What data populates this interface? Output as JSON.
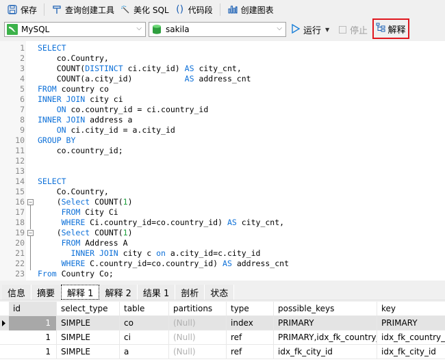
{
  "toolbar": {
    "save": "保存",
    "query_builder": "查询创建工具",
    "beautify": "美化 SQL",
    "snippet": "代码段",
    "create_chart": "创建图表"
  },
  "connection": {
    "selected": "MySQL"
  },
  "database": {
    "selected": "sakila"
  },
  "actions": {
    "run": "运行",
    "stop": "停止",
    "explain": "解释"
  },
  "editor": {
    "lines": [
      {
        "n": "1",
        "html": "<span class='kw'>SELECT</span>"
      },
      {
        "n": "2",
        "html": "    co.Country,"
      },
      {
        "n": "3",
        "html": "    COUNT(<span class='kw'>DISTINCT</span> ci.city_id) <span class='kw'>AS</span> city_cnt,"
      },
      {
        "n": "4",
        "html": "    COUNT(a.city_id)           <span class='kw'>AS</span> address_cnt"
      },
      {
        "n": "5",
        "html": "<span class='kw'>FROM</span> country co"
      },
      {
        "n": "6",
        "html": "<span class='kw'>INNER JOIN</span> city ci"
      },
      {
        "n": "7",
        "html": "    <span class='kw'>ON</span> co.country_id = ci.country_id"
      },
      {
        "n": "8",
        "html": "<span class='kw'>INNER JOIN</span> address a"
      },
      {
        "n": "9",
        "html": "    <span class='kw'>ON</span> ci.city_id = a.city_id"
      },
      {
        "n": "10",
        "html": "<span class='kw'>GROUP BY</span>"
      },
      {
        "n": "11",
        "html": "    co.country_id;"
      },
      {
        "n": "12",
        "html": ""
      },
      {
        "n": "13",
        "html": ""
      },
      {
        "n": "14",
        "html": "<span class='kw'>SELECT</span>"
      },
      {
        "n": "15",
        "html": "    Co.Country,"
      },
      {
        "n": "16",
        "html": "    (<span class='kw'>Select</span> COUNT(<span class='num'>1</span>)"
      },
      {
        "n": "17",
        "html": "     <span class='kw'>FROM</span> City Ci"
      },
      {
        "n": "18",
        "html": "     <span class='kw'>WHERE</span> Ci.country_id=co.country_id) <span class='kw'>AS</span> city_cnt,"
      },
      {
        "n": "19",
        "html": "    (<span class='kw'>Select</span> COUNT(<span class='num'>1</span>)"
      },
      {
        "n": "20",
        "html": "     <span class='kw'>FROM</span> Address A"
      },
      {
        "n": "21",
        "html": "       <span class='kw'>INNER JOIN</span> city c <span class='kw'>on</span> a.city_id=c.city_id"
      },
      {
        "n": "22",
        "html": "     <span class='kw'>WHERE</span> C.country_id=co.country_id) <span class='kw'>AS</span> address_cnt"
      },
      {
        "n": "23",
        "html": "<span class='kw'>From</span> Country Co;"
      }
    ]
  },
  "result_tabs": [
    "信息",
    "摘要",
    "解释 1",
    "解释 2",
    "结果 1",
    "剖析",
    "状态"
  ],
  "active_tab": "解释 1",
  "explain_table": {
    "columns": [
      "id",
      "select_type",
      "table",
      "partitions",
      "type",
      "possible_keys",
      "key"
    ],
    "rows": [
      [
        "1",
        "SIMPLE",
        "co",
        "(Null)",
        "index",
        "PRIMARY",
        "PRIMARY"
      ],
      [
        "1",
        "SIMPLE",
        "ci",
        "(Null)",
        "ref",
        "PRIMARY,idx_fk_country_",
        "idx_fk_country_id"
      ],
      [
        "1",
        "SIMPLE",
        "a",
        "(Null)",
        "ref",
        "idx_fk_city_id",
        "idx_fk_city_id"
      ]
    ]
  },
  "colors": {
    "keyword": "#0b6fd8",
    "number": "#1a9e3a",
    "highlight": "#e0161e"
  }
}
